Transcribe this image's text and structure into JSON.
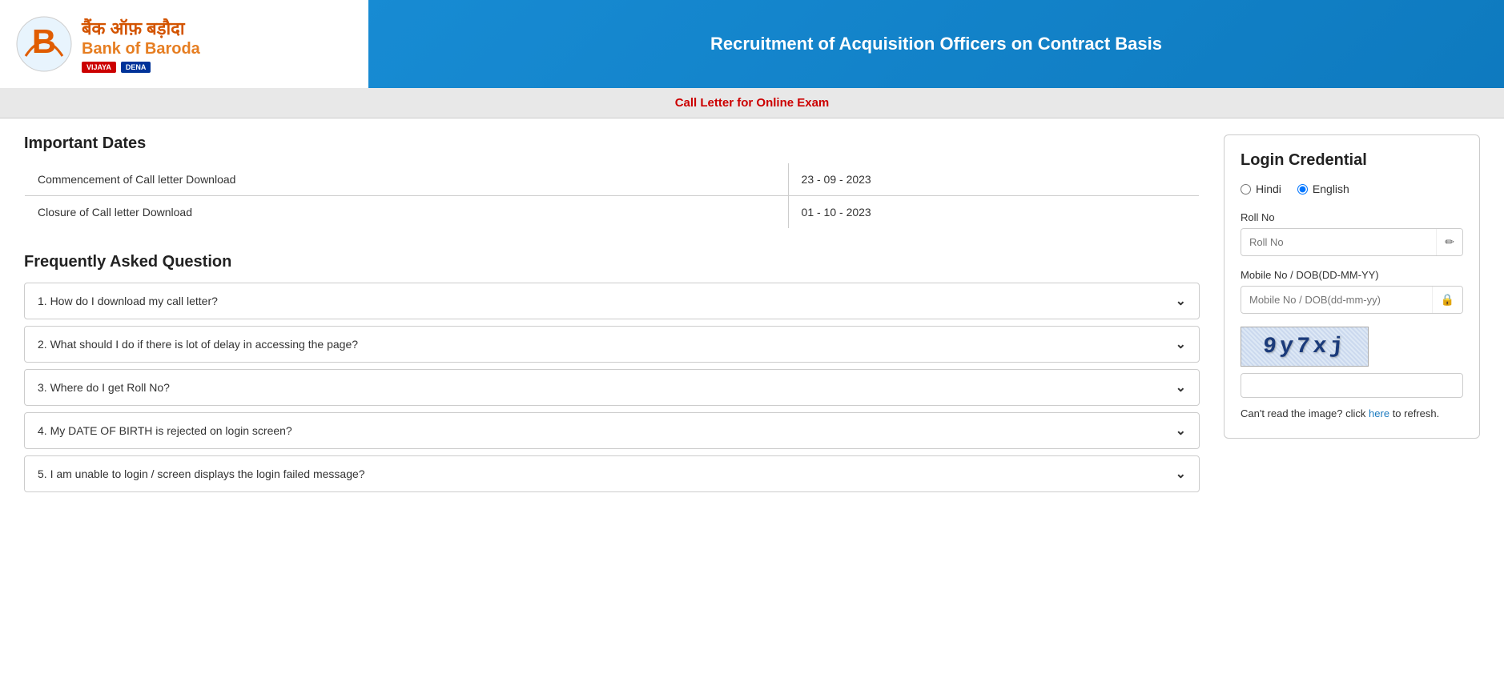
{
  "header": {
    "logo_hindi": "बैंक ऑफ़ बड़ौदा",
    "logo_english": "Bank of Baroda",
    "badge_vijaya": "VIJAYA",
    "badge_dena": "DENA",
    "title": "Recruitment of Acquisition Officers on Contract Basis"
  },
  "sub_header": {
    "label": "Call Letter for Online Exam"
  },
  "important_dates": {
    "section_title": "Important Dates",
    "rows": [
      {
        "label": "Commencement of Call letter Download",
        "date": "23 - 09 - 2023"
      },
      {
        "label": "Closure of Call letter Download",
        "date": "01 - 10 - 2023"
      }
    ]
  },
  "faq": {
    "section_title": "Frequently Asked Question",
    "items": [
      {
        "text": "1. How do I download my call letter?"
      },
      {
        "text": "2. What should I do if there is lot of delay in accessing the page?"
      },
      {
        "text": "3. Where do I get Roll No?"
      },
      {
        "text": "4. My DATE OF BIRTH is rejected on login screen?"
      },
      {
        "text": "5. I am unable to login / screen displays the login failed message?"
      }
    ]
  },
  "login": {
    "title": "Login Credential",
    "language_options": [
      {
        "id": "hindi",
        "label": "Hindi"
      },
      {
        "id": "english",
        "label": "English"
      }
    ],
    "roll_no_label": "Roll No",
    "roll_no_placeholder": "Roll No",
    "mobile_dob_label": "Mobile No / DOB(DD-MM-YY)",
    "mobile_dob_placeholder": "Mobile No / DOB(dd-mm-yy)",
    "captcha_value": "9y7xj",
    "captcha_hint": "Can't read the image? click",
    "captcha_hint_link": "here",
    "captcha_hint_suffix": "to refresh.",
    "edit_icon": "✏",
    "lock_icon": "🔒"
  }
}
